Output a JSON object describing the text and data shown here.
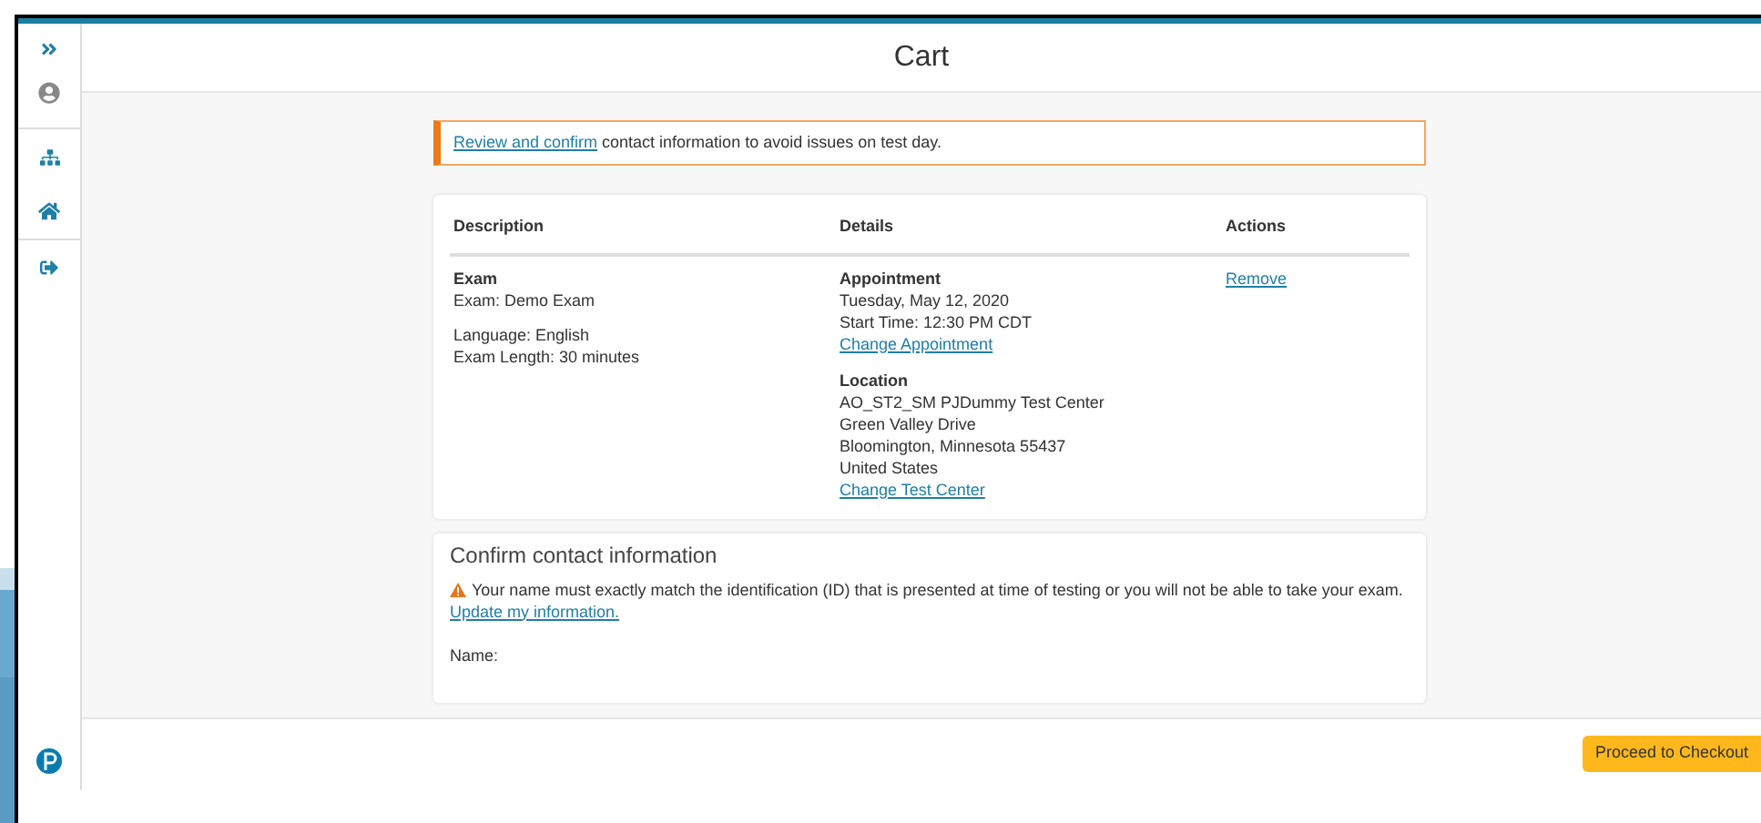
{
  "page_title": "Cart",
  "alert": {
    "link": "Review and confirm",
    "text": " contact information to avoid issues on test day."
  },
  "table": {
    "columns": [
      "Description",
      "Details",
      "Actions"
    ],
    "rows": [
      {
        "description": {
          "title": "Exam",
          "lines": [
            "Exam: Demo Exam"
          ],
          "extra": [
            "Language: English",
            "Exam Length: 30 minutes"
          ]
        },
        "appointment": {
          "title": "Appointment",
          "lines": [
            "Tuesday, May 12, 2020",
            "Start Time: 12:30 PM CDT"
          ],
          "link": "Change Appointment"
        },
        "location": {
          "title": "Location",
          "lines": [
            "AO_ST2_SM PJDummy Test Center",
            "Green Valley Drive",
            "Bloomington, Minnesota 55437",
            "United States"
          ],
          "link": "Change Test Center"
        },
        "action": "Remove"
      }
    ]
  },
  "contact": {
    "title": "Confirm contact information",
    "warning": "Your name must exactly match the identification (ID) that is presented at time of testing or you will not be able to take your exam.",
    "link": "Update my information.",
    "field_label": "Name:"
  },
  "checkout_button": "Proceed to Checkout"
}
